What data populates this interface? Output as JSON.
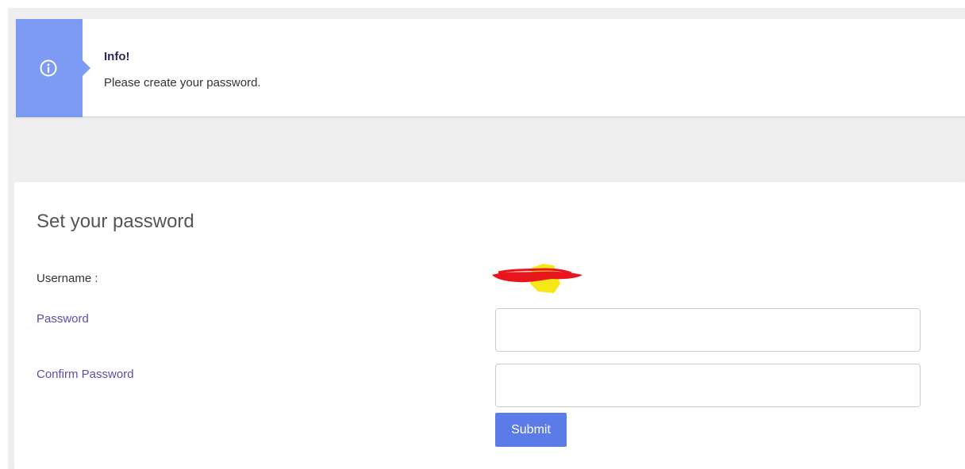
{
  "alert": {
    "title": "Info!",
    "message": "Please create your password.",
    "icon": "info-icon",
    "accent_color": "#7d9bf2"
  },
  "form": {
    "title": "Set your password",
    "username_label": "Username :",
    "password_label": "Password",
    "password_value": "",
    "confirm_label": "Confirm Password",
    "confirm_value": "",
    "submit_label": "Submit",
    "label_color": "#5a4ea8",
    "button_color": "#5b7be8"
  }
}
